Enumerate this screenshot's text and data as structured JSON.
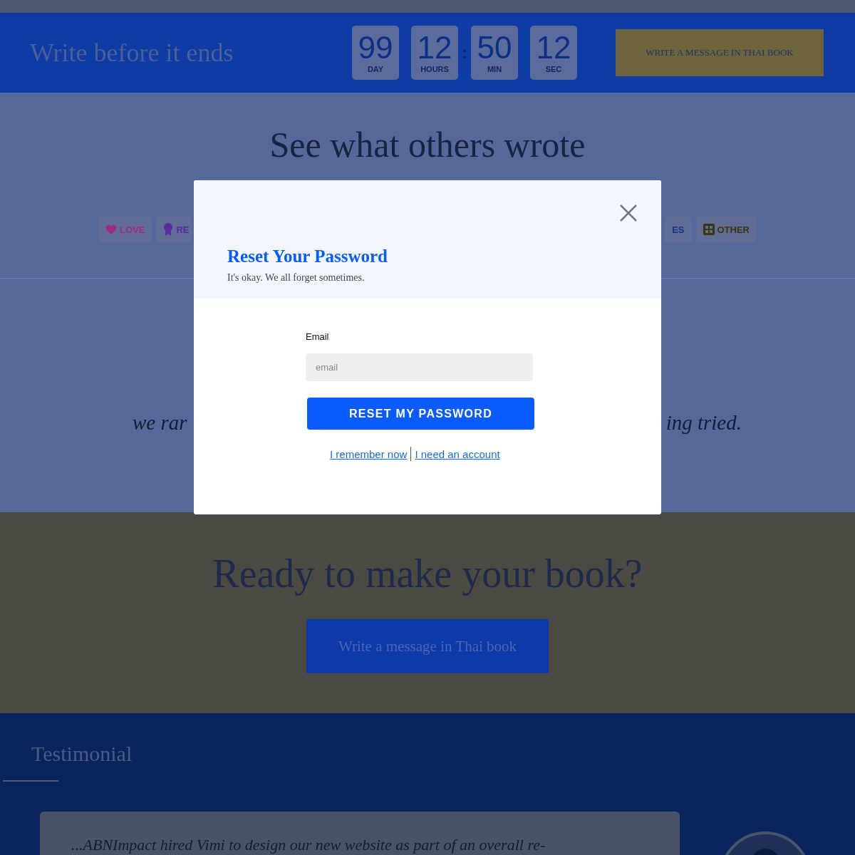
{
  "header": {
    "title": "Write before it ends",
    "countdown": [
      {
        "value": "99",
        "unit": "DAY"
      },
      {
        "value": "12",
        "unit": "HOURS"
      },
      {
        "value": "50",
        "unit": "MIN"
      },
      {
        "value": "12",
        "unit": "SEC"
      }
    ],
    "separator": ":",
    "cta": "WRITE A MESSAGE IN THAI BOOK"
  },
  "others": {
    "heading": "See what others wrote",
    "tags": [
      {
        "kind": "heart",
        "label": "LOVE",
        "color": "#a02a80"
      },
      {
        "kind": "ribbon",
        "label": "RE",
        "color": "#5a2aa0"
      },
      {
        "kind": "plain",
        "label": "ES",
        "color": "#1e2f86"
      },
      {
        "kind": "grid",
        "label": "OTHER",
        "color": "#3e3510"
      }
    ],
    "quote_left": "we rar",
    "quote_right": "ing tried."
  },
  "ready": {
    "heading": "Ready to make your book?",
    "button": "Write a message in Thai book"
  },
  "testimonial": {
    "heading": "Testimonial",
    "quote": "...ABNImpact hired Vimi to design our new website as part of an overall re-"
  },
  "modal": {
    "title": "Reset Your Password",
    "subtitle": "It's okay. We all forget sometimes.",
    "email_label": "Email",
    "email_placeholder": "email",
    "submit": "RESET MY PASSWORD",
    "links": [
      "I remember now",
      "I need an account"
    ]
  }
}
